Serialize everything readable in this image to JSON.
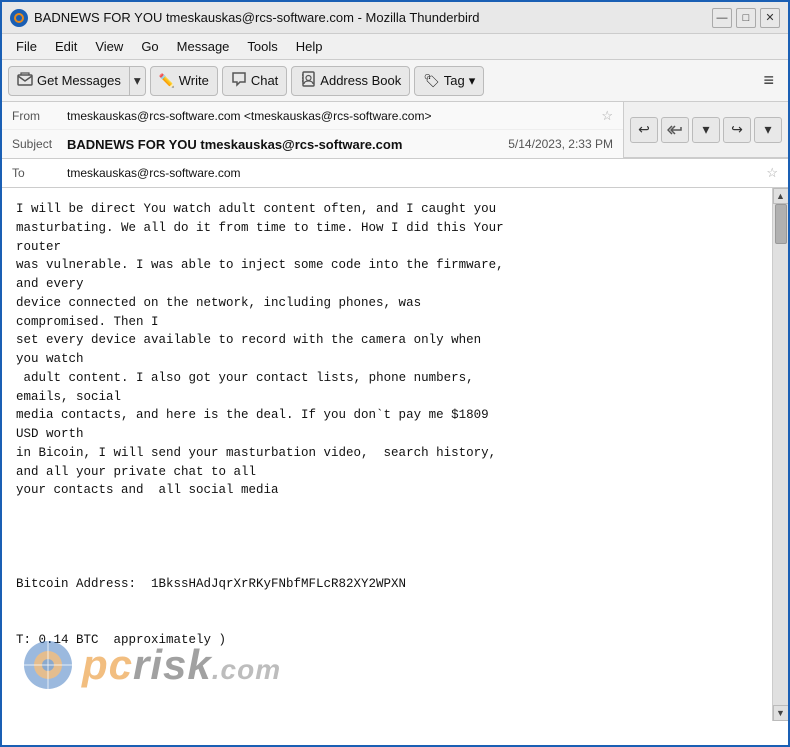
{
  "titleBar": {
    "title": "BADNEWS FOR YOU tmeskauskas@rcs-software.com - Mozilla Thunderbird",
    "icon": "TB",
    "controls": {
      "minimize": "—",
      "maximize": "□",
      "close": "✕"
    }
  },
  "menuBar": {
    "items": [
      "File",
      "Edit",
      "View",
      "Go",
      "Message",
      "Tools",
      "Help"
    ]
  },
  "toolbar": {
    "getMessages": "Get Messages",
    "write": "Write",
    "chat": "Chat",
    "addressBook": "Address Book",
    "tag": "Tag",
    "hamburger": "≡"
  },
  "emailHeader": {
    "fromLabel": "From",
    "fromValue": "tmeskauskas@rcs-software.com <tmeskauskas@rcs-software.com>",
    "subjectLabel": "Subject",
    "subjectValue": "BADNEWS FOR YOU tmeskauskas@rcs-software.com",
    "dateValue": "5/14/2023, 2:33 PM",
    "toLabel": "To",
    "toValue": "tmeskauskas@rcs-software.com"
  },
  "replyToolbar": {
    "replyBtn": "↩",
    "replyAllBtn": "↩↩",
    "downBtn": "▾",
    "forwardBtn": "↪",
    "moreBtn": "▾"
  },
  "emailBody": {
    "text": "I will be direct You watch adult content often, and I caught you\nmasturbating. We all do it from time to time. How I did this Your\nrouter\nwas vulnerable. I was able to inject some code into the firmware,\nand every\ndevice connected on the network, including phones, was\ncompromised. Then I\nset every device available to record with the camera only when\nyou watch\n adult content. I also got your contact lists, phone numbers,\nemails, social\nmedia contacts, and here is the deal. If you don`t pay me $1809\nUSD worth\nin Bicoin, I will send your masturbation video,  search history,\nand all your private chat to all\nyour contacts and  all social media\n\n\n\n\nBitcoin Address:  1BkssHAdJqrXrRKyFNbfMFLcR82XY2WPXN\n\n\nT: 0.14 BTC  approximately )"
  },
  "watermark": {
    "text": "pcrisk",
    "dotCom": ".com"
  }
}
